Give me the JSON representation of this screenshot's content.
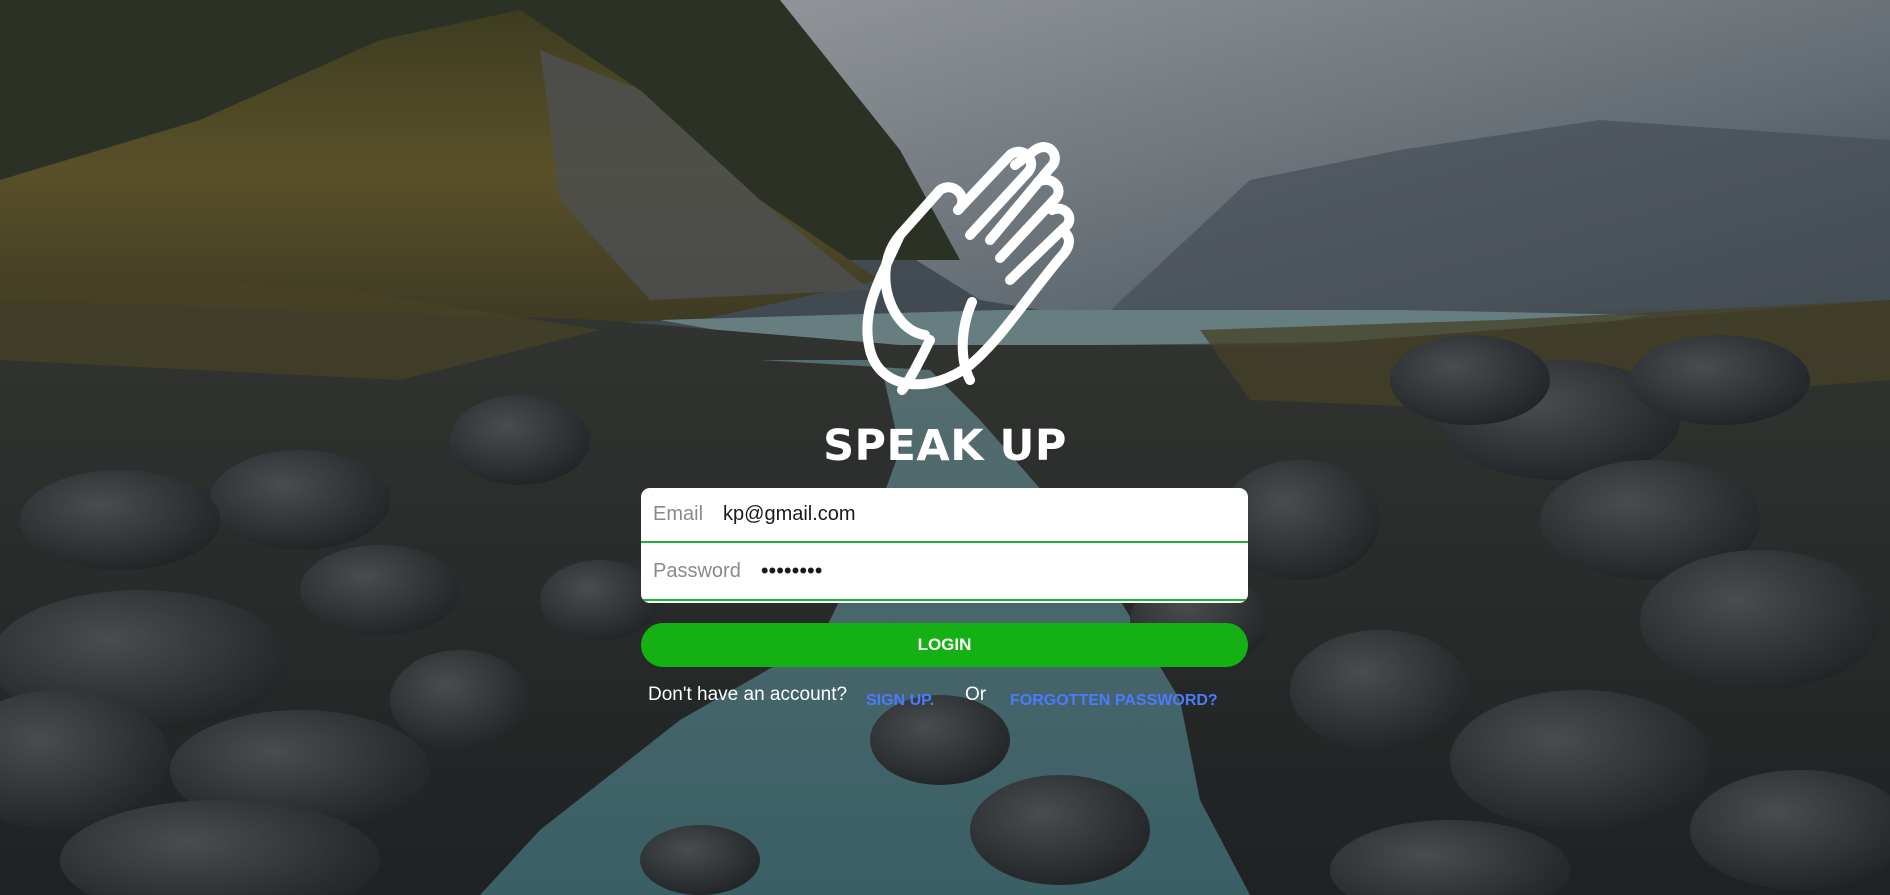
{
  "brand": {
    "name": "SPEAK UP"
  },
  "login_form": {
    "email_label": "Email",
    "email_value": "kp@gmail.com",
    "password_label": "Password",
    "password_value": "••••••••"
  },
  "login_button": {
    "label": "LOGIN"
  },
  "footer": {
    "no_account_text": "Don't have an account?",
    "signup_link": "SIGN UP.",
    "or_text": "Or",
    "forgot_link": "FORGOTTEN PASSWORD?"
  },
  "colors": {
    "accent_green": "#14b014",
    "field_underline": "#1db33a",
    "link_blue": "#4a7bff"
  },
  "icons": {
    "logo": "waving-hand-icon"
  }
}
